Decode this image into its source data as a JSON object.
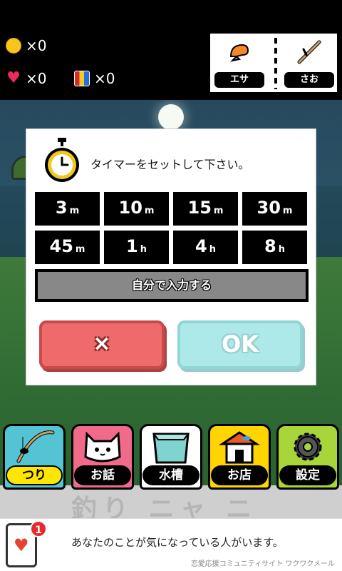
{
  "hud": {
    "coins": "×0",
    "hearts": "×0",
    "cans": "×0",
    "bait_label": "エサ",
    "rod_label": "さお"
  },
  "dialog": {
    "message": "タイマーをセットして下さい。",
    "timer_options": [
      {
        "num": "3",
        "unit": "m"
      },
      {
        "num": "10",
        "unit": "m"
      },
      {
        "num": "15",
        "unit": "m"
      },
      {
        "num": "30",
        "unit": "m"
      },
      {
        "num": "45",
        "unit": "m"
      },
      {
        "num": "1",
        "unit": "h"
      },
      {
        "num": "4",
        "unit": "h"
      },
      {
        "num": "8",
        "unit": "h"
      }
    ],
    "manual_label": "自分で入力する",
    "cancel_label": "×",
    "ok_label": "OK"
  },
  "nav": {
    "items": [
      {
        "label": "つり",
        "icon": "fishing-rod-icon",
        "color": "#54c3d3",
        "active": true
      },
      {
        "label": "お話",
        "icon": "cat-face-icon",
        "color": "#f06a8a",
        "active": false
      },
      {
        "label": "水槽",
        "icon": "aquarium-icon",
        "color": "#ffffff",
        "active": false
      },
      {
        "label": "お店",
        "icon": "shop-icon",
        "color": "#ffd400",
        "active": false
      },
      {
        "label": "設定",
        "icon": "gear-icon",
        "color": "#a8d53a",
        "active": false
      }
    ]
  },
  "background": {
    "logo_text": "釣り ニャ ニ"
  },
  "ad": {
    "badge": "1",
    "text": "あなたのことが気になっている人がいます。",
    "sub": "恋愛応援コミュニティサイト ワクワクメール"
  },
  "colors": {
    "cancel": "#ef6b6b",
    "ok": "#aee9e9",
    "coin": "#f7c51c",
    "heart": "#ea2d57"
  }
}
